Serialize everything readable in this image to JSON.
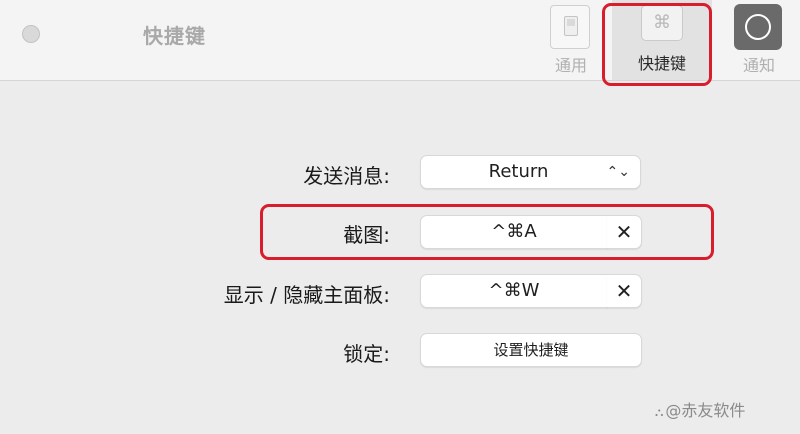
{
  "window": {
    "title": "快捷键"
  },
  "toolbar": {
    "items": [
      {
        "label": "通用",
        "icon": "switch-icon",
        "selected": false
      },
      {
        "label": "快捷键",
        "icon": "command-key-icon",
        "selected": true,
        "glyph": "⌘"
      },
      {
        "label": "通知",
        "icon": "notification-icon",
        "selected": false
      }
    ]
  },
  "form": {
    "send_message": {
      "label": "发送消息:",
      "value": "Return",
      "chevron": "⌃⌄"
    },
    "screenshot": {
      "label": "截图:",
      "shortcut": "^⌘A",
      "clear": "✕"
    },
    "toggle_panel": {
      "label": "显示 / 隐藏主面板:",
      "shortcut": "^⌘W",
      "clear": "✕"
    },
    "lock": {
      "label": "锁定:",
      "button": "设置快捷键"
    }
  },
  "watermark": {
    "symbol": "⛬",
    "text": "@赤友软件"
  },
  "colors": {
    "highlight": "#d81e2c",
    "background": "#ececec"
  }
}
